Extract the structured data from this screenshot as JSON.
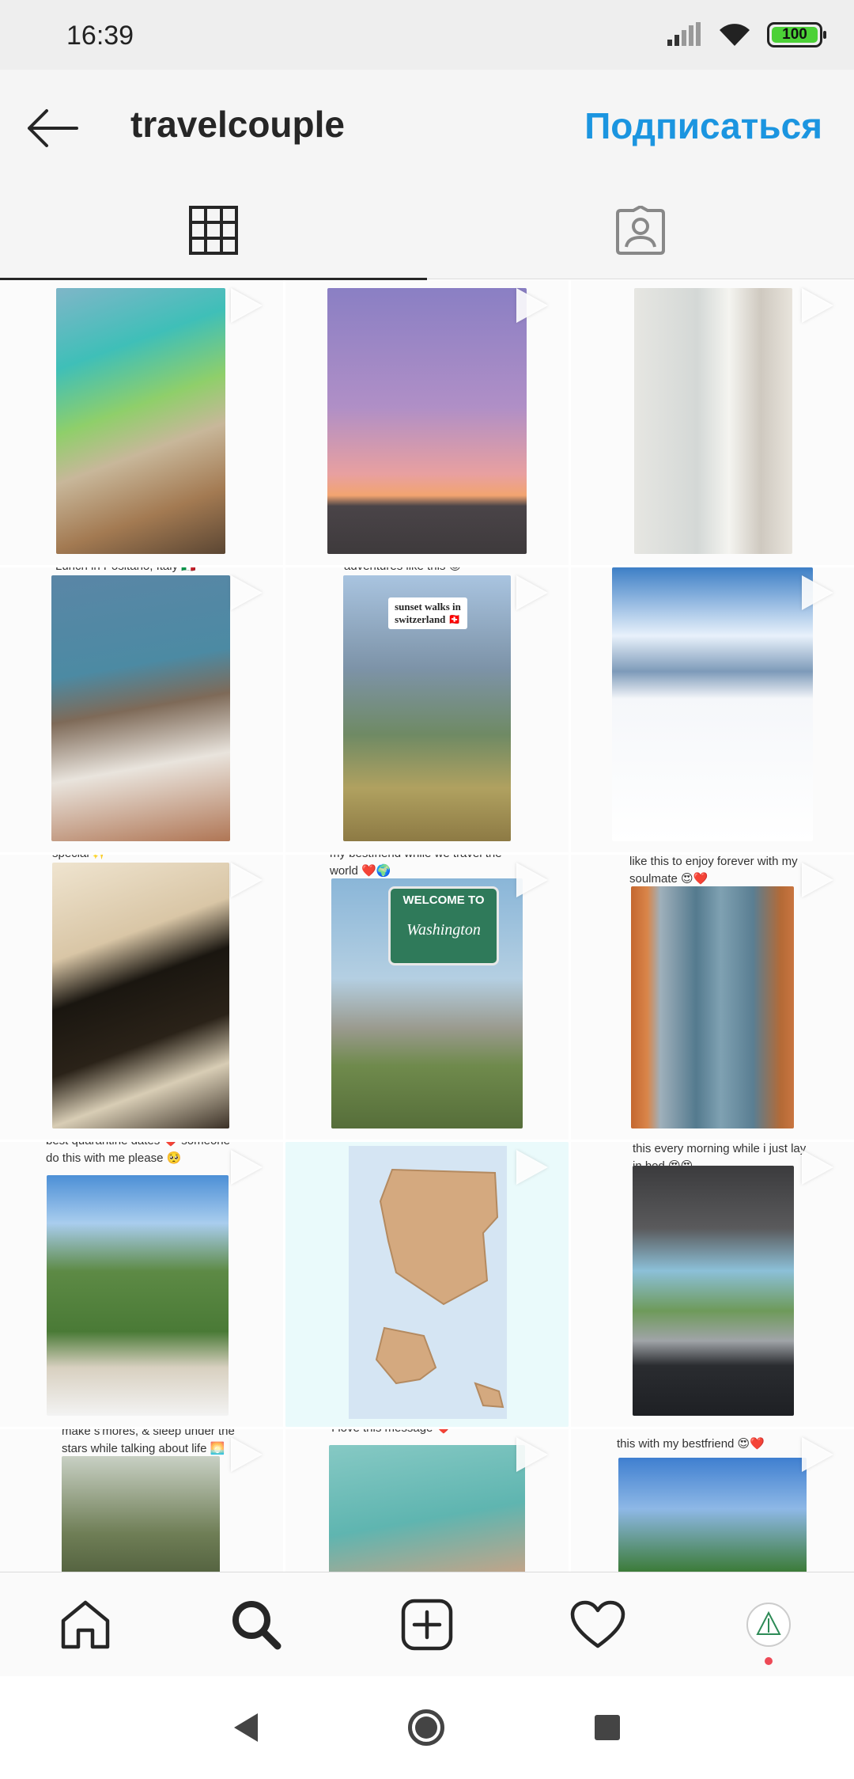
{
  "status": {
    "time": "16:39",
    "battery": "100"
  },
  "header": {
    "username": "travelcouple",
    "follow_label": "Подписаться"
  },
  "tabs": [
    {
      "name": "grid",
      "active": true
    },
    {
      "name": "tagged",
      "active": false
    }
  ],
  "grid": {
    "posts": [
      {
        "caption": ""
      },
      {
        "caption": ""
      },
      {
        "caption": ""
      },
      {
        "caption": "Lunch in Positano, Italy 🇮🇹"
      },
      {
        "caption": "adventures like this 😊"
      },
      {
        "caption": ""
      },
      {
        "caption": "special ✨"
      },
      {
        "caption": "my bestfriend while we travel the world ❤️🌍"
      },
      {
        "caption": "like this to enjoy forever with my soulmate 😍❤️"
      },
      {
        "caption": "best quarantine dates ❤️ someone do this with me please 🥺"
      },
      {
        "caption": ""
      },
      {
        "caption": "this every morning while i just lay in bed 😍😍"
      },
      {
        "caption": "make s'mores, & sleep under the stars while talking about life 🌅"
      },
      {
        "caption": "I love this message ❤️"
      },
      {
        "caption": "this with my bestfriend 😍❤️"
      }
    ],
    "overlay_texts": {
      "sunset": "sunset walks in switzerland 🇨🇭",
      "sign_top": "WELCOME TO",
      "sign_state": "Washington"
    }
  },
  "colors": {
    "accent": "#1b95e0",
    "notification": "#ed4956"
  }
}
